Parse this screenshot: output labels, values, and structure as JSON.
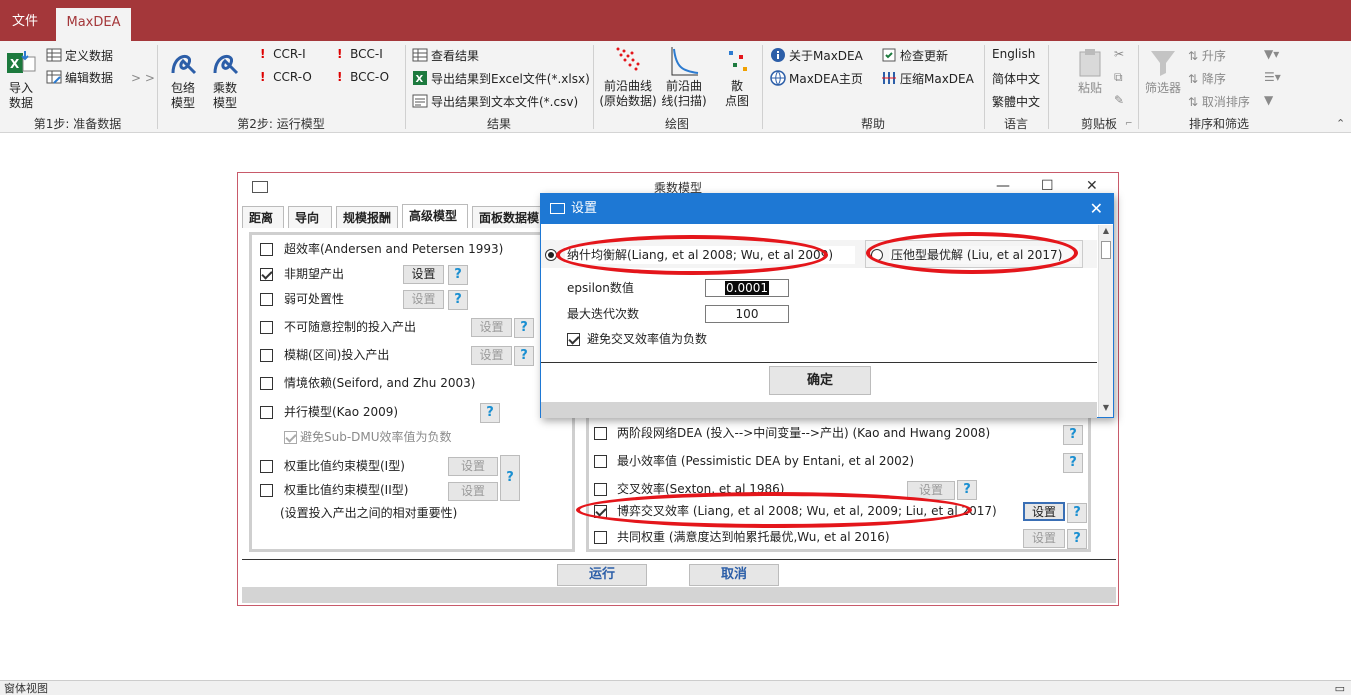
{
  "app": {
    "tabs": [
      "文件",
      "MaxDEA"
    ]
  },
  "ribbon": {
    "step1": {
      "import_label": "导入\n数据",
      "define_data": "定义数据",
      "edit_data": "编辑数据",
      "more": "> >",
      "group_label": "第1步: 准备数据"
    },
    "step2": {
      "envelope_label": "包络\n模型",
      "multiplier_label": "乘数\n模型",
      "ccr_i": "CCR-I",
      "ccr_o": "CCR-O",
      "bcc_i": "BCC-I",
      "bcc_o": "BCC-O",
      "group_label": "第2步: 运行模型"
    },
    "results": {
      "view": "查看结果",
      "export_excel": "导出结果到Excel文件(*.xlsx)",
      "export_text": "导出结果到文本文件(*.csv)",
      "group_label": "结果"
    },
    "plot": {
      "frontier_raw": "前沿曲线\n(原始数据)",
      "frontier_scan": "前沿曲\n线(扫描)",
      "scatter": "散\n点图",
      "group_label": "绘图"
    },
    "help": {
      "about": "关于MaxDEA",
      "home": "MaxDEA主页",
      "check_update": "检查更新",
      "compress": "压缩MaxDEA",
      "group_label": "帮助"
    },
    "language": {
      "english": "English",
      "simplified": "简体中文",
      "traditional": "繁體中文",
      "group_label": "语言"
    },
    "clipboard": {
      "paste": "粘贴",
      "group_label": "剪贴板"
    },
    "sort_filter": {
      "filter": "筛选器",
      "asc": "升序",
      "desc": "降序",
      "cancel_sort": "取消排序",
      "group_label": "排序和筛选"
    }
  },
  "main_window": {
    "title": "乘数模型",
    "tabs": [
      "距离",
      "导向",
      "规模报酬",
      "高级模型",
      "面板数据模"
    ],
    "left_panel": {
      "items": [
        {
          "label": "超效率(Andersen and Petersen 1993)",
          "checked": false
        },
        {
          "label": "非期望产出",
          "checked": true,
          "button": "设置"
        },
        {
          "label": "弱可处置性",
          "checked": false,
          "button": "设置"
        },
        {
          "label": "不可随意控制的投入产出",
          "checked": false,
          "button": "设置"
        },
        {
          "label": "模糊(区间)投入产出",
          "checked": false,
          "button": "设置"
        },
        {
          "label": "情境依赖(Seiford, and Zhu 2003)",
          "checked": false
        },
        {
          "label": "并行模型(Kao 2009)",
          "checked": false
        },
        {
          "label": "避免Sub-DMU效率值为负数",
          "checked": true,
          "disabled": true
        },
        {
          "label": "权重比值约束模型(I型)",
          "checked": false,
          "button": "设置"
        },
        {
          "label": "权重比值约束模型(II型)",
          "checked": false,
          "button": "设置"
        }
      ],
      "note": "(设置投入产出之间的相对重要性)"
    },
    "right_panel": {
      "items": [
        {
          "label": "两阶段网络DEA (投入-->中间变量-->产出) (Kao and Hwang 2008)",
          "checked": false
        },
        {
          "label": "最小效率值 (Pessimistic DEA by Entani, et al 2002)",
          "checked": false
        },
        {
          "label": "交叉效率(Sexton, et al 1986)",
          "checked": false,
          "button": "设置"
        },
        {
          "label": "博弈交叉效率 (Liang, et al 2008; Wu, et al, 2009; Liu, et al 2017)",
          "checked": true,
          "button": "设置"
        },
        {
          "label": "共同权重 (满意度达到帕累托最优,Wu, et al 2016)",
          "checked": false,
          "button": "设置"
        }
      ]
    },
    "help_glyph": "?",
    "run": "运行",
    "cancel": "取消"
  },
  "dialog": {
    "title": "设置",
    "option_nash": "纳什均衡解(Liang, et al 2008; Wu, et al 2009)",
    "option_compress": "压他型最优解 (Liu, et al 2017)",
    "epsilon_label": "epsilon数值",
    "epsilon_value": "0.0001",
    "max_iter_label": "最大迭代次数",
    "max_iter_value": "100",
    "avoid_negative": "避免交叉效率值为负数",
    "ok": "确定",
    "close_glyph": "✕"
  },
  "statusbar": {
    "text": "窗体视图"
  },
  "colors": {
    "titlebar": "#a4373a",
    "dialog_accent": "#1e78d4",
    "annotation": "#e4161b",
    "help_blue": "#1a8fd1"
  }
}
